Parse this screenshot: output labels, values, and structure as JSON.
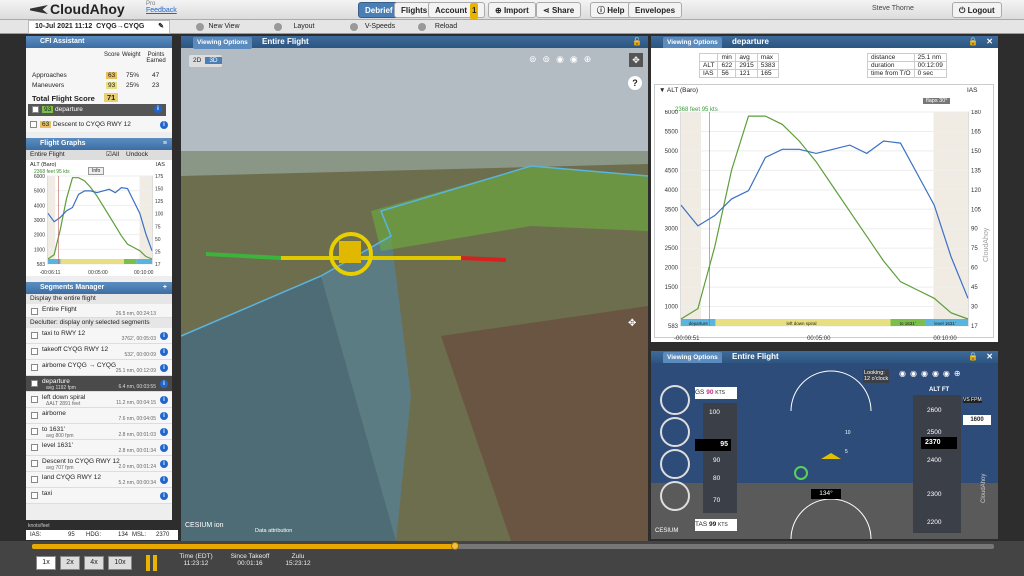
{
  "app": {
    "name": "CloudAhoy",
    "pro": "Pro",
    "feedback": "Feedback"
  },
  "nav": {
    "debrief": "Debrief",
    "flights": "Flights",
    "account": "Account",
    "account_badge": "1",
    "import": "Import",
    "share": "Share",
    "help": "Help",
    "envelopes": "Envelopes",
    "user": "Steve Thorne",
    "logout": "Logout"
  },
  "flight": {
    "date": "10-Jul 2021 11:12",
    "route": "CYQG→CYQG"
  },
  "toolbar": {
    "new_view": "New View",
    "layout": "Layout",
    "vspeeds": "V-Speeds",
    "reload": "Reload"
  },
  "cfi": {
    "title": "CFI Assistant",
    "cols": [
      "Score",
      "Weight",
      "Points Earned"
    ],
    "rows": [
      {
        "label": "Approaches",
        "score": "63",
        "weight": "75%",
        "points": "47"
      },
      {
        "label": "Maneuvers",
        "score": "93",
        "weight": "25%",
        "points": "23"
      }
    ],
    "total_label": "Total Flight Score",
    "total_value": "71",
    "items": [
      {
        "score": "93",
        "label": "departure"
      },
      {
        "score": "63",
        "label": "Descent to CYQG RWY 12"
      }
    ]
  },
  "graphs": {
    "title": "Flight Graphs",
    "scope": "Entire Flight",
    "all": "All",
    "undock": "Undock",
    "alt_label": "ALT (Baro)",
    "ias_label": "IAS",
    "readout": "2368 feet  95 kts",
    "info": "Info",
    "y_left": [
      "6000",
      "5000",
      "4000",
      "3000",
      "2000",
      "1000",
      "583"
    ],
    "y_right": [
      "175",
      "150",
      "125",
      "100",
      "75",
      "50",
      "25",
      "17"
    ],
    "x_ticks": [
      "-00:06:11",
      "00:05:00",
      "00:10:00"
    ]
  },
  "segments": {
    "title": "Segments Manager",
    "note1": "Display the entire flight",
    "entire": {
      "name": "Entire Flight",
      "meta": "26.5 nm, 00:24:13"
    },
    "note2": "Declutter: display only selected segments",
    "list": [
      {
        "name": "taxi to RWY 12",
        "meta": "3762', 00:05:03"
      },
      {
        "name": "takeoff CYQG RWY 12",
        "meta": "532', 00:00:09"
      },
      {
        "name": "airborne CYQG → CYQG",
        "meta": "25.1 nm, 00:12:09"
      },
      {
        "name": "departure",
        "sub": "avg 1192 fpm",
        "meta": "6.4 nm, 00:03:55",
        "selected": true
      },
      {
        "name": "left down spiral",
        "sub": "ΔALT 2891 feet",
        "meta": "11.2 nm, 00:04:15"
      },
      {
        "name": "airborne",
        "meta": "7.6 nm, 00:04:05"
      },
      {
        "name": "to 1631'",
        "sub": "avg 800 fpm",
        "meta": "2.8 nm, 00:01:03"
      },
      {
        "name": "level 1631'",
        "meta": "2.8 nm, 00:01:34"
      },
      {
        "name": "Descent to CYQG RWY 12",
        "sub": "avg 707 fpm",
        "meta": "2.0 nm, 00:01:24"
      },
      {
        "name": "land CYQG RWY 12",
        "meta": "5.2 nm, 00:00:34"
      },
      {
        "name": "taxi",
        "meta": ""
      }
    ]
  },
  "status": {
    "units": "knots/feet",
    "ias_label": "IAS:",
    "ias": "95",
    "hdg_label": "HDG:",
    "hdg": "134",
    "msl_label": "MSL:",
    "msl": "2370"
  },
  "map": {
    "viewing": "Viewing Options",
    "title": "Entire Flight",
    "btn_2d": "2D",
    "btn_3d": "3D",
    "cesium": "CESIUM ion",
    "attribution": "Data attribution",
    "help": "?"
  },
  "right_top": {
    "viewing": "Viewing Options",
    "title": "departure",
    "stats_hdr": [
      "min",
      "avg",
      "max"
    ],
    "stats": [
      {
        "label": "ALT",
        "min": "622",
        "avg": "2915",
        "max": "5383"
      },
      {
        "label": "IAS",
        "min": "56",
        "avg": "121",
        "max": "165"
      }
    ],
    "info": [
      {
        "label": "distance",
        "value": "25.1 nm"
      },
      {
        "label": "duration",
        "value": "00:12:09"
      },
      {
        "label": "time from T/O",
        "value": "0 sec"
      }
    ],
    "alt_label": "ALT (Baro)",
    "ias_label": "IAS",
    "readout": "2368 feet  95 kts",
    "flaps": "flaps 30°",
    "info_btn": "Info",
    "y_left": [
      "6000",
      "5500",
      "5000",
      "4500",
      "4000",
      "3500",
      "3000",
      "2500",
      "2000",
      "1500",
      "1000",
      "583"
    ],
    "y_right": [
      "180",
      "165",
      "150",
      "135",
      "120",
      "105",
      "90",
      "75",
      "60",
      "45",
      "30",
      "17"
    ],
    "x_ticks": [
      "-00:00:51",
      "00:05:00",
      "00:10:00"
    ],
    "segbar": [
      "departure",
      "left down spiral",
      "to 1631'",
      "level 1631'"
    ],
    "watermark": "CloudAhoy"
  },
  "right_bot": {
    "viewing": "Viewing Options",
    "title": "Entire Flight",
    "looking": "Looking:",
    "clock": "12 o'clock",
    "gs_label": "GS",
    "gs": "90",
    "gs_unit": "KTS",
    "ias_box": "95",
    "speeds": [
      "100",
      "90",
      "80",
      "70"
    ],
    "tas_label": "TAS",
    "tas": "99",
    "tas_unit": "KTS",
    "alt_label": "ALT FT",
    "vs_label": "VS FPM",
    "vs": "1600",
    "alt_box": "2370",
    "alts": [
      "2600",
      "2500",
      "2400",
      "2300",
      "2200"
    ],
    "heading": "134°",
    "pitch": [
      "10",
      "5"
    ],
    "cesium": "CESIUM",
    "watermark": "CloudAhoy"
  },
  "playback": {
    "speeds": [
      "1x",
      "2x",
      "4x",
      "10x"
    ],
    "time_label": "Time (EDT)",
    "time": "11:23:12",
    "since_label": "Since Takeoff",
    "since": "00:01:16",
    "zulu_label": "Zulu",
    "zulu": "15:23:12",
    "progress": 0.44
  },
  "colors": {
    "accent": "#3c6ea4",
    "alt_line": "#5c9e3a",
    "ias_line": "#3a6fc4",
    "track_green": "#7ec33a",
    "track_blue": "#5ab4e0",
    "progress": "#e8a800"
  }
}
